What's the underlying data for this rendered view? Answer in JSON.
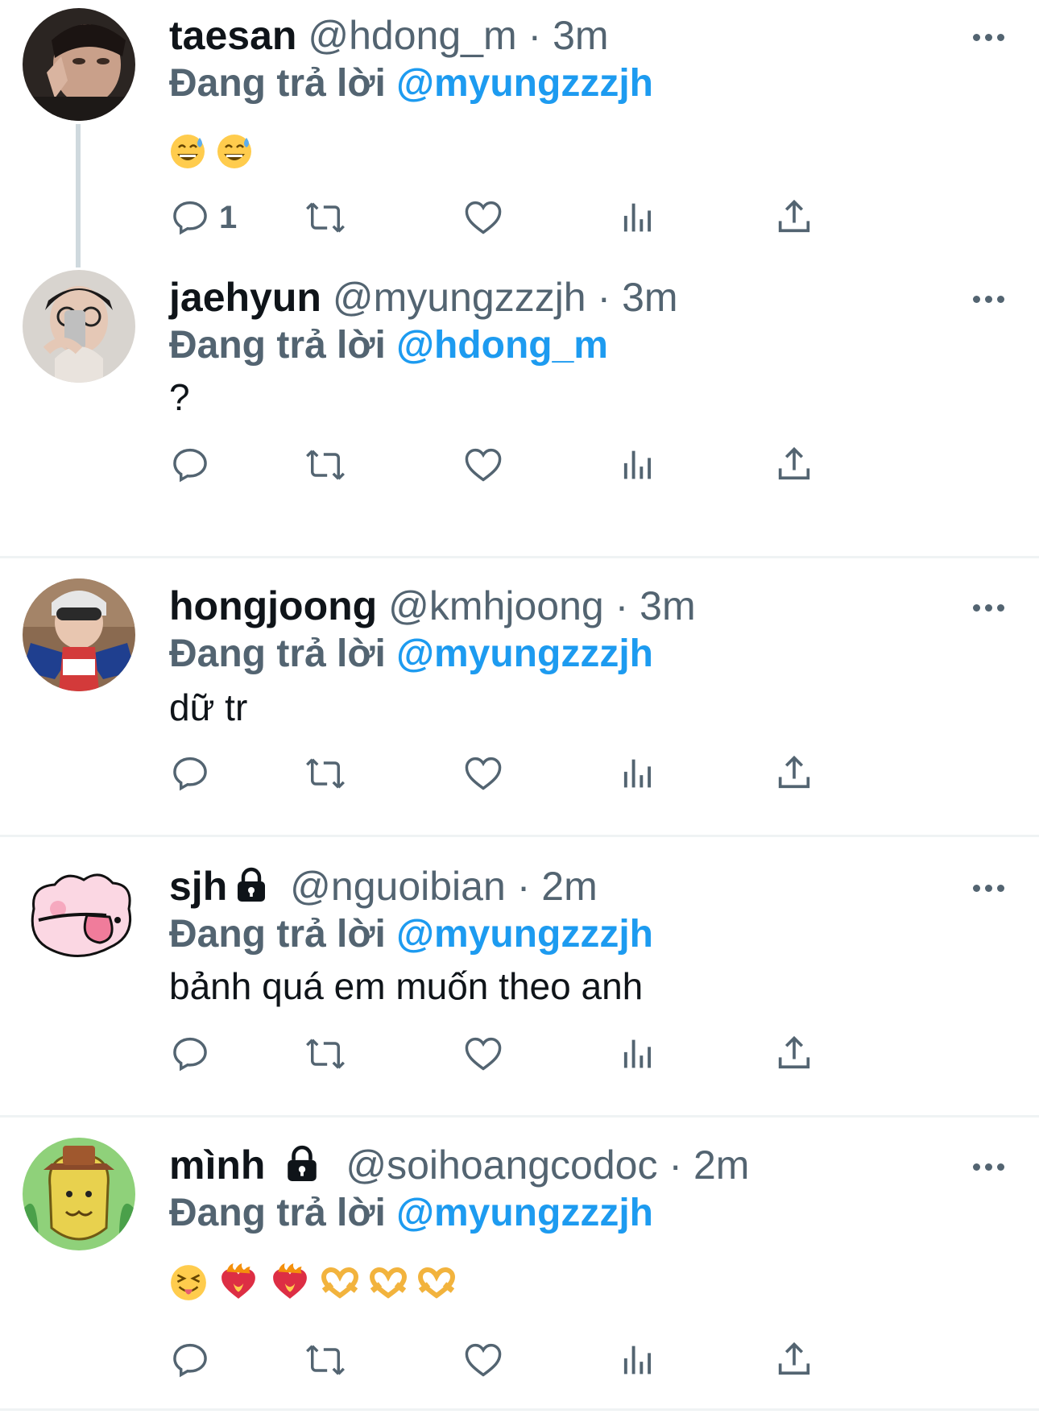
{
  "reply_label": "Đang trả lời",
  "tweets": [
    {
      "name": "taesan",
      "handle": "@hdong_m",
      "sep": "·",
      "time": "3m",
      "reply_to": "@myungzzzjh",
      "text": "",
      "emojis": [
        "grinning-sweat-face",
        "grinning-sweat-face"
      ],
      "reply_count": "1",
      "locked": false
    },
    {
      "name": "jaehyun",
      "handle": "@myungzzzjh",
      "sep": "·",
      "time": "3m",
      "reply_to": "@hdong_m",
      "text": "?",
      "emojis": [],
      "reply_count": "",
      "locked": false
    },
    {
      "name": "hongjoong",
      "handle": "@kmhjoong",
      "sep": "·",
      "time": "3m",
      "reply_to": "@myungzzzjh",
      "text": "dữ tr",
      "emojis": [],
      "reply_count": "",
      "locked": false
    },
    {
      "name": "sjh",
      "handle": "@nguoibian",
      "sep": "·",
      "time": "2m",
      "reply_to": "@myungzzzjh",
      "text": "bảnh quá em muốn theo anh",
      "emojis": [],
      "reply_count": "",
      "locked": true
    },
    {
      "name": "mình",
      "handle": "@soihoangcodoc",
      "sep": "·",
      "time": "2m",
      "reply_to": "@myungzzzjh",
      "text": "",
      "emojis": [
        "squinting-tongue-face",
        "heart-on-fire",
        "heart-on-fire",
        "heart-hands",
        "heart-hands",
        "heart-hands"
      ],
      "reply_count": "",
      "locked": true
    }
  ],
  "colors": {
    "text": "#0f1419",
    "secondary": "#536471",
    "accent": "#1d9bf0",
    "divider": "#eff3f4"
  }
}
